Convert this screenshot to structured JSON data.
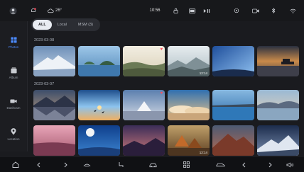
{
  "status_bar": {
    "weather_temp": "26°",
    "time": "10:56"
  },
  "sidebar": {
    "items": [
      {
        "label": "Photos",
        "icon": "photo-grid-icon",
        "active": true
      },
      {
        "label": "Album",
        "icon": "album-icon",
        "active": false
      },
      {
        "label": "Dashcam",
        "icon": "camera-icon",
        "active": false
      },
      {
        "label": "Location",
        "icon": "location-pin-icon",
        "active": false
      }
    ]
  },
  "filters": {
    "all": "ALL",
    "local": "Local",
    "usb": "MSM (3)"
  },
  "sections": [
    {
      "date": "2023-03-08",
      "thumbnails": [
        {
          "scene": "snow-mountain",
          "favorite": false,
          "duration": ""
        },
        {
          "scene": "lake-islands",
          "favorite": false,
          "duration": ""
        },
        {
          "scene": "grassland-hills",
          "favorite": true,
          "duration": ""
        },
        {
          "scene": "misty-mountains",
          "favorite": false,
          "duration": "12:14"
        },
        {
          "scene": "blue-sky-night",
          "favorite": false,
          "duration": ""
        },
        {
          "scene": "sunset-pier",
          "favorite": false,
          "duration": ""
        }
      ]
    },
    {
      "date": "2023-03-07",
      "thumbnails": [
        {
          "scene": "mountain-reflection",
          "favorite": false,
          "duration": ""
        },
        {
          "scene": "sunset-birds",
          "favorite": false,
          "duration": ""
        },
        {
          "scene": "desert-boat",
          "favorite": true,
          "duration": ""
        },
        {
          "scene": "cloud-sea",
          "favorite": false,
          "duration": ""
        },
        {
          "scene": "rock-lake",
          "favorite": false,
          "duration": ""
        },
        {
          "scene": "lake-sunset-hills",
          "favorite": false,
          "duration": ""
        }
      ]
    },
    {
      "date": "",
      "thumbnails": [
        {
          "scene": "pink-beach",
          "favorite": false,
          "duration": ""
        },
        {
          "scene": "moon-night",
          "favorite": false,
          "duration": ""
        },
        {
          "scene": "purple-mountains",
          "favorite": false,
          "duration": ""
        },
        {
          "scene": "autumn-lake",
          "favorite": false,
          "duration": "12:14"
        },
        {
          "scene": "red-mountain",
          "favorite": false,
          "duration": ""
        },
        {
          "scene": "starry-peak",
          "favorite": false,
          "duration": ""
        }
      ]
    }
  ],
  "dock": {
    "icons": [
      "home-icon",
      "chevron-left-icon",
      "chevron-right-icon",
      "fan-icon",
      "seat-icon",
      "car-icon",
      "apps-grid-icon",
      "car-side-icon",
      "chevron-left-icon",
      "chevron-right-icon",
      "volume-icon"
    ]
  },
  "colors": {
    "accent": "#4d8cff",
    "favorite": "#ff4d5e",
    "background": "#1a1b1f"
  }
}
